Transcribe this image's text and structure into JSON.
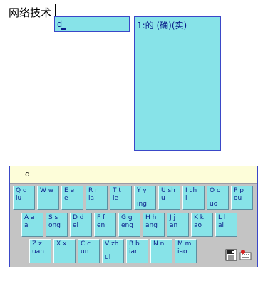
{
  "document": {
    "text": "网络技术"
  },
  "composition": {
    "text": "d"
  },
  "candidates": [
    {
      "text": "1:的 (确)(实)"
    }
  ],
  "keyboard": {
    "input_text": "d",
    "rows": [
      [
        {
          "top": "Q q",
          "bottom": "iu"
        },
        {
          "top": "W w",
          "bottom": ""
        },
        {
          "top": "E e",
          "bottom": "e"
        },
        {
          "top": "R r",
          "bottom": "ia"
        },
        {
          "top": "T t",
          "bottom": "ie"
        },
        {
          "top": "Y y",
          "bottom": "ing",
          "low": true
        },
        {
          "top": "U sh",
          "bottom": "u"
        },
        {
          "top": "I ch",
          "bottom": "i"
        },
        {
          "top": "O o",
          "bottom": "uo",
          "low": true
        },
        {
          "top": "P p",
          "bottom": "ou"
        }
      ],
      [
        {
          "top": "A a",
          "bottom": "a"
        },
        {
          "top": "S s",
          "bottom": "ong"
        },
        {
          "top": "D d",
          "bottom": "ei"
        },
        {
          "top": "F f",
          "bottom": "en"
        },
        {
          "top": "G g",
          "bottom": "eng"
        },
        {
          "top": "H h",
          "bottom": "ang"
        },
        {
          "top": "J j",
          "bottom": "an"
        },
        {
          "top": "K k",
          "bottom": "ao"
        },
        {
          "top": "L l",
          "bottom": "ai"
        }
      ],
      [
        {
          "top": "Z z",
          "bottom": "uan"
        },
        {
          "top": "X x",
          "bottom": ""
        },
        {
          "top": "C c",
          "bottom": "un"
        },
        {
          "top": "V zh",
          "bottom": "ui",
          "low": true
        },
        {
          "top": "B b",
          "bottom": "ian"
        },
        {
          "top": "N n",
          "bottom": ""
        },
        {
          "top": "M m",
          "bottom": "iao"
        }
      ]
    ]
  },
  "tools": [
    {
      "icon": "floppy-disk-icon"
    },
    {
      "icon": "keyboard-settings-icon"
    }
  ],
  "colors": {
    "key_fill": "#87e3e8",
    "key_text": "#0a1e8a",
    "frame_border": "#3a47c8",
    "input_bar": "#fdfdd9",
    "keyboard_bg": "#c4c4c4"
  }
}
